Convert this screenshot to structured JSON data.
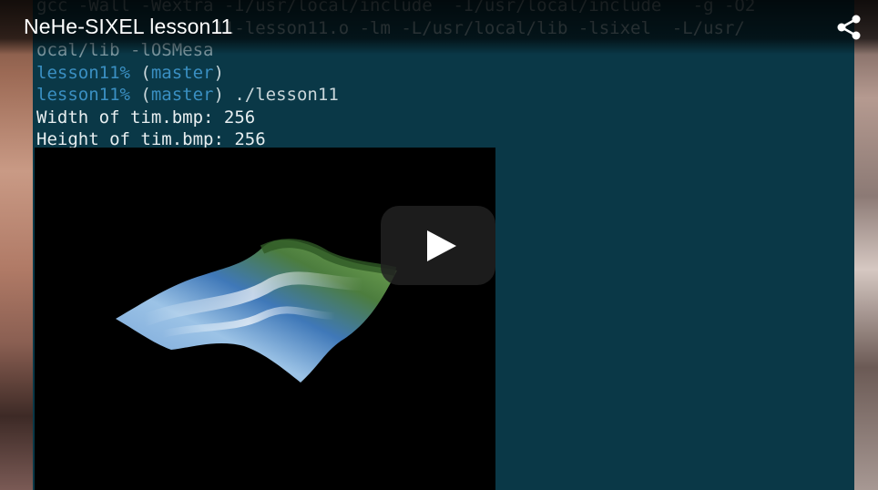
{
  "video": {
    "title": "NeHe-SIXEL lesson11",
    "share_icon": "share-icon",
    "play_icon": "play-icon"
  },
  "terminal": {
    "lines": [
      {
        "parts": [
          {
            "text": "gcc -Wall -Wextra -I/usr/local/include  -I/usr/local/include   -g -O2",
            "style": "dim"
          }
        ]
      },
      {
        "parts": [
          {
            "text": "                 11-lesson11.o -lm -L/usr/local/lib -lsixel  -L/usr/",
            "style": "dim"
          }
        ]
      },
      {
        "parts": [
          {
            "text": "ocal/lib -lOSMesa",
            "style": "dim"
          }
        ]
      },
      {
        "parts": [
          {
            "text": "lesson11%",
            "style": "prompt"
          },
          {
            "text": " (",
            "style": "paren"
          },
          {
            "text": "master",
            "style": "branch"
          },
          {
            "text": ")",
            "style": "paren"
          }
        ]
      },
      {
        "parts": [
          {
            "text": "lesson11%",
            "style": "prompt"
          },
          {
            "text": " (",
            "style": "paren"
          },
          {
            "text": "master",
            "style": "branch"
          },
          {
            "text": ") ./lesson11",
            "style": "paren"
          }
        ]
      },
      {
        "parts": [
          {
            "text": "Width of tim.bmp: 256",
            "style": ""
          }
        ]
      },
      {
        "parts": [
          {
            "text": "Height of tim.bmp: 256",
            "style": ""
          }
        ]
      }
    ]
  },
  "colors": {
    "terminal_bg": "#0a3847",
    "prompt": "#3a8fc2",
    "text": "#e7eef0"
  }
}
